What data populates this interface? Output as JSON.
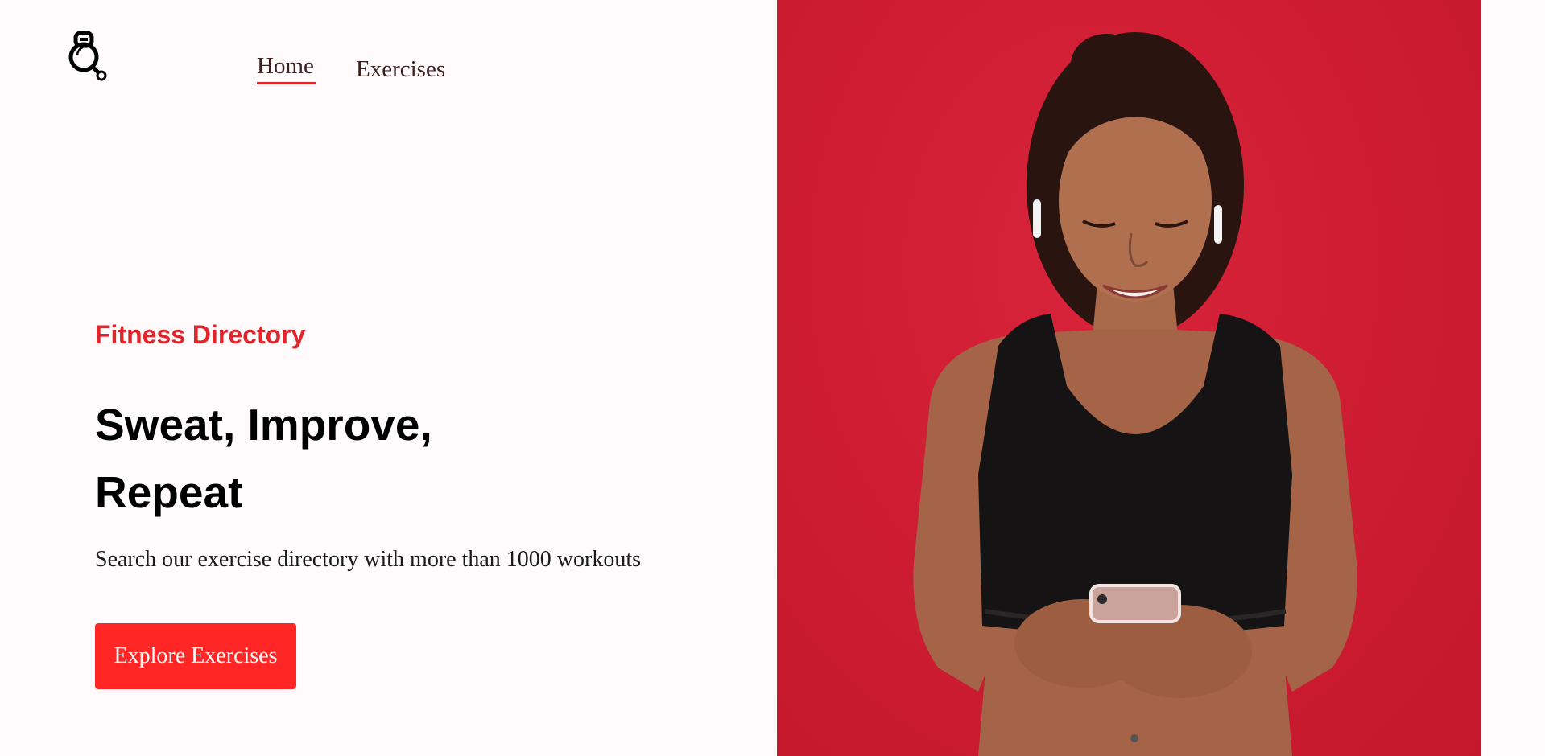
{
  "nav": {
    "logo_icon": "kettlebell-search-icon",
    "items": [
      {
        "label": "Home",
        "active": true
      },
      {
        "label": "Exercises",
        "active": false
      }
    ]
  },
  "hero": {
    "eyebrow": "Fitness Directory",
    "title_line1": "Sweat, Improve,",
    "title_line2": "Repeat",
    "subtitle": "Search our exercise directory with more than 1000 workouts",
    "cta_label": "Explore Exercises"
  },
  "colors": {
    "accent": "#ff2625",
    "eyebrow": "#e0262c",
    "photo_background": "#cf1d33",
    "page_background": "#fffafb"
  }
}
